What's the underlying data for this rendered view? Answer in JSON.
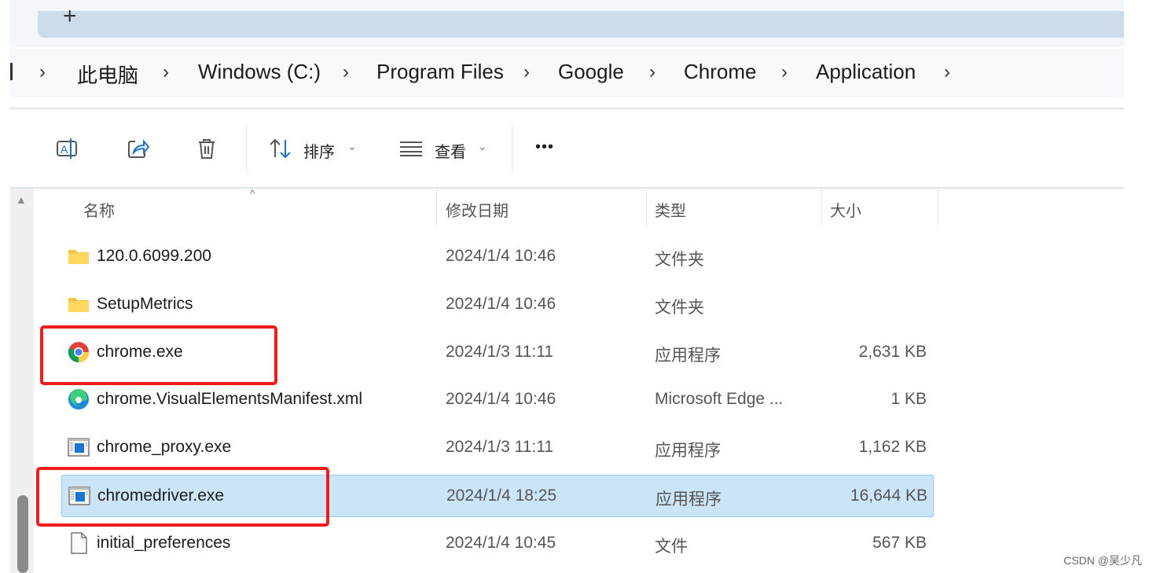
{
  "tabbar": {
    "new_tab": "+"
  },
  "breadcrumb": [
    "此电脑",
    "Windows (C:)",
    "Program Files",
    "Google",
    "Chrome",
    "Application"
  ],
  "toolbar": {
    "sort_label": "排序",
    "view_label": "查看",
    "more": "•••"
  },
  "columns": {
    "name": "名称",
    "date": "修改日期",
    "type": "类型",
    "size": "大小"
  },
  "files": [
    {
      "name": "120.0.6099.200",
      "date": "2024/1/4 10:46",
      "type": "文件夹",
      "size": "",
      "icon": "folder-icon"
    },
    {
      "name": "SetupMetrics",
      "date": "2024/1/4 10:46",
      "type": "文件夹",
      "size": "",
      "icon": "folder-icon"
    },
    {
      "name": "chrome.exe",
      "date": "2024/1/3 11:11",
      "type": "应用程序",
      "size": "2,631 KB",
      "icon": "chrome-icon"
    },
    {
      "name": "chrome.VisualElementsManifest.xml",
      "date": "2024/1/4 10:46",
      "type": "Microsoft Edge ...",
      "size": "1 KB",
      "icon": "edge-icon"
    },
    {
      "name": "chrome_proxy.exe",
      "date": "2024/1/3 11:11",
      "type": "应用程序",
      "size": "1,162 KB",
      "icon": "app-icon"
    },
    {
      "name": "chromedriver.exe",
      "date": "2024/1/4 18:25",
      "type": "应用程序",
      "size": "16,644 KB",
      "icon": "app-icon",
      "selected": true
    },
    {
      "name": "initial_preferences",
      "date": "2024/1/4 10:45",
      "type": "文件",
      "size": "567 KB",
      "icon": "file-icon"
    }
  ],
  "watermark": "CSDN @吴少凡",
  "colors": {
    "selection": "#cce4f7",
    "highlight_box": "#f01c1c"
  }
}
